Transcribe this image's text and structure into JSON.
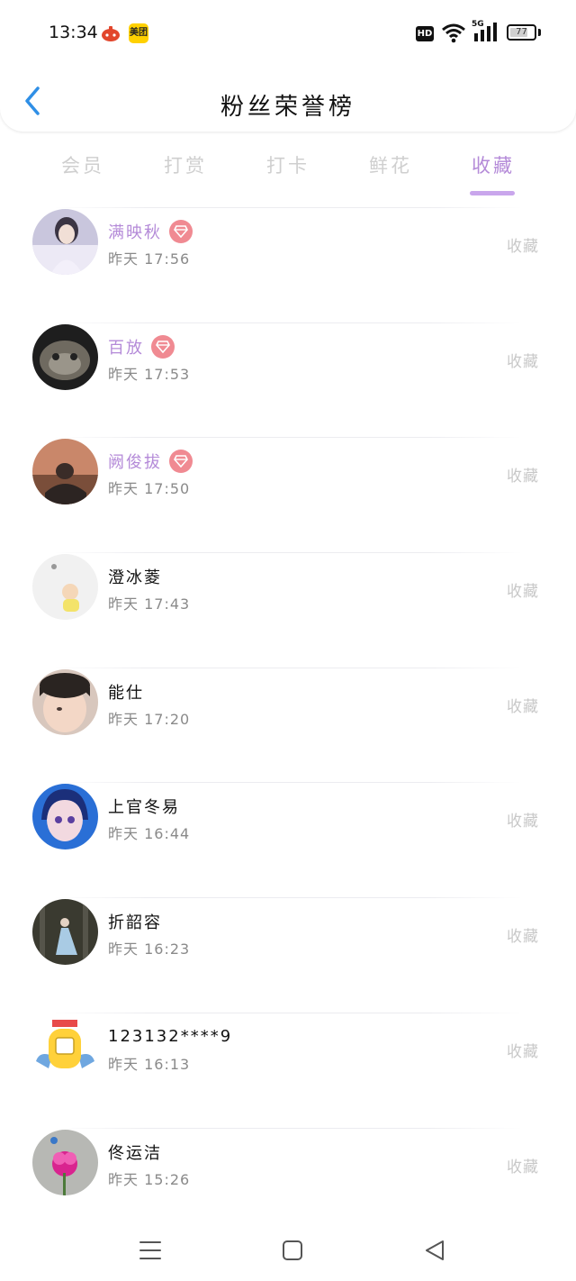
{
  "status_bar": {
    "time": "13:34",
    "app_badge_text": "美团",
    "hd_label": "HD",
    "network_label": "5G",
    "battery_level": "77",
    "battery_percent": 77
  },
  "header": {
    "title": "粉丝荣誉榜",
    "back_icon": "chevron-left-icon"
  },
  "tabs": [
    {
      "label": "会员",
      "active": false
    },
    {
      "label": "打赏",
      "active": false
    },
    {
      "label": "打卡",
      "active": false
    },
    {
      "label": "鲜花",
      "active": false
    },
    {
      "label": "收藏",
      "active": true
    }
  ],
  "rows": [
    {
      "name": "满映秋",
      "time": "昨天 17:56",
      "action": "收藏",
      "vip": true
    },
    {
      "name": "百放",
      "time": "昨天 17:53",
      "action": "收藏",
      "vip": true
    },
    {
      "name": "阙俊拔",
      "time": "昨天 17:50",
      "action": "收藏",
      "vip": true
    },
    {
      "name": "澄冰菱",
      "time": "昨天 17:43",
      "action": "收藏",
      "vip": false
    },
    {
      "name": "能仕",
      "time": "昨天 17:20",
      "action": "收藏",
      "vip": false
    },
    {
      "name": "上官冬易",
      "time": "昨天 16:44",
      "action": "收藏",
      "vip": false
    },
    {
      "name": "折韶容",
      "time": "昨天 16:23",
      "action": "收藏",
      "vip": false
    },
    {
      "name": "123132****9",
      "time": "昨天 16:13",
      "action": "收藏",
      "vip": false
    },
    {
      "name": "佟运洁",
      "time": "昨天 15:26",
      "action": "收藏",
      "vip": false
    }
  ],
  "colors": {
    "accent": "#b48ad8",
    "tab_underline": "#c9a6ec",
    "vip_badge": "#f08a92",
    "inactive_tab": "#cfcfcf",
    "back_arrow": "#2f8fe6"
  },
  "nav": {
    "menu_icon": "menu-lines-icon",
    "home_icon": "square-home-icon",
    "back_icon": "triangle-back-icon"
  }
}
